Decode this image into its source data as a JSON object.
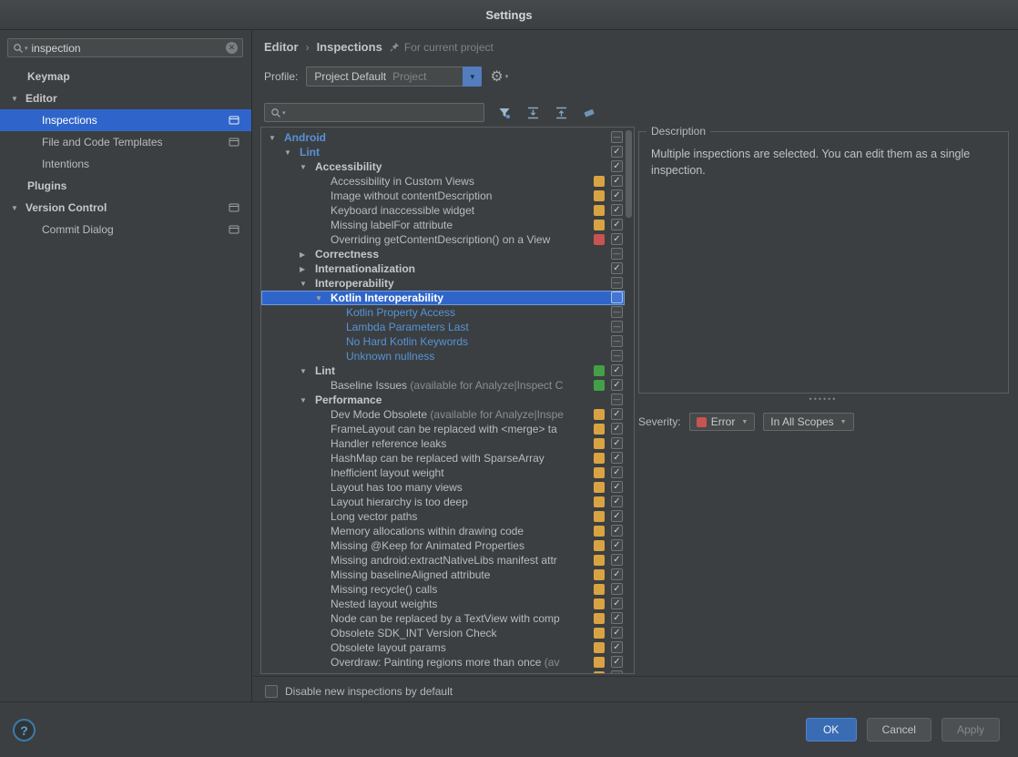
{
  "window": {
    "title": "Settings"
  },
  "colors": {
    "selection": "#2f65ca",
    "tree_link_blue": "#5693d8",
    "badge_yellow": "#d9a343",
    "badge_red": "#c75450",
    "badge_green": "#43a047",
    "severity_error": "#c75450",
    "ok_button": "#3a6cb4"
  },
  "sidebar": {
    "search": {
      "value": "inspection"
    },
    "items": [
      {
        "label": "Keymap",
        "indent": 1,
        "bold": true
      },
      {
        "label": "Editor",
        "indent": 0,
        "bold": true,
        "expander": "down"
      },
      {
        "label": "Inspections",
        "indent": 2,
        "selected": true,
        "scoped": true
      },
      {
        "label": "File and Code Templates",
        "indent": 2,
        "scoped": true
      },
      {
        "label": "Intentions",
        "indent": 2
      },
      {
        "label": "Plugins",
        "indent": 1,
        "bold": true
      },
      {
        "label": "Version Control",
        "indent": 0,
        "bold": true,
        "expander": "down",
        "scoped": true
      },
      {
        "label": "Commit Dialog",
        "indent": 2,
        "scoped": true
      }
    ]
  },
  "breadcrumb": {
    "path": [
      "Editor",
      "Inspections"
    ],
    "separator": "›",
    "scope_label": "For current project"
  },
  "profile": {
    "label": "Profile:",
    "value": "Project Default",
    "scope": "Project"
  },
  "tree": {
    "rows": [
      {
        "label": "Android",
        "level": 0,
        "bold": true,
        "color": "blue",
        "expander": "down",
        "check": "dash"
      },
      {
        "label": "Lint",
        "level": 1,
        "bold": true,
        "color": "blue",
        "expander": "down",
        "check": "checked"
      },
      {
        "label": "Accessibility",
        "level": 2,
        "bold": true,
        "expander": "down",
        "check": "checked"
      },
      {
        "label": "Accessibility in Custom Views",
        "level": 3,
        "badge": "yellow",
        "check": "checked"
      },
      {
        "label": "Image without contentDescription",
        "level": 3,
        "badge": "yellow",
        "check": "checked"
      },
      {
        "label": "Keyboard inaccessible widget",
        "level": 3,
        "badge": "yellow",
        "check": "checked"
      },
      {
        "label": "Missing labelFor attribute",
        "level": 3,
        "badge": "yellow",
        "check": "checked"
      },
      {
        "label": "Overriding getContentDescription() on a View",
        "level": 3,
        "badge": "red",
        "check": "checked"
      },
      {
        "label": "Correctness",
        "level": 2,
        "bold": true,
        "expander": "right",
        "check": "dash"
      },
      {
        "label": "Internationalization",
        "level": 2,
        "bold": true,
        "expander": "right",
        "check": "checked"
      },
      {
        "label": "Interoperability",
        "level": 2,
        "bold": true,
        "expander": "down",
        "check": "dash"
      },
      {
        "label": "Kotlin Interoperability",
        "level": 3,
        "bold": true,
        "expander": "down",
        "check": "empty",
        "selected": true
      },
      {
        "label": "Kotlin Property Access",
        "level": 4,
        "color": "blue",
        "check": "dash"
      },
      {
        "label": "Lambda Parameters Last",
        "level": 4,
        "color": "blue",
        "check": "dash"
      },
      {
        "label": "No Hard Kotlin Keywords",
        "level": 4,
        "color": "blue",
        "check": "dash"
      },
      {
        "label": "Unknown nullness",
        "level": 4,
        "color": "blue",
        "check": "dash"
      },
      {
        "label": "Lint",
        "level": 2,
        "bold": true,
        "expander": "down",
        "badge": "green",
        "check": "checked"
      },
      {
        "label": "Baseline Issues",
        "suffix": " (available for Analyze|Inspect C",
        "level": 3,
        "badge": "green",
        "check": "checked"
      },
      {
        "label": "Performance",
        "level": 2,
        "bold": true,
        "expander": "down",
        "check": "dash"
      },
      {
        "label": "Dev Mode Obsolete",
        "suffix": " (available for Analyze|Inspe",
        "level": 3,
        "badge": "yellow",
        "check": "checked"
      },
      {
        "label": "FrameLayout can be replaced with <merge> ta",
        "level": 3,
        "badge": "yellow",
        "check": "checked"
      },
      {
        "label": "Handler reference leaks",
        "level": 3,
        "badge": "yellow",
        "check": "checked"
      },
      {
        "label": "HashMap can be replaced with SparseArray",
        "level": 3,
        "badge": "yellow",
        "check": "checked"
      },
      {
        "label": "Inefficient layout weight",
        "level": 3,
        "badge": "yellow",
        "check": "checked"
      },
      {
        "label": "Layout has too many views",
        "level": 3,
        "badge": "yellow",
        "check": "checked"
      },
      {
        "label": "Layout hierarchy is too deep",
        "level": 3,
        "badge": "yellow",
        "check": "checked"
      },
      {
        "label": "Long vector paths",
        "level": 3,
        "badge": "yellow",
        "check": "checked"
      },
      {
        "label": "Memory allocations within drawing code",
        "level": 3,
        "badge": "yellow",
        "check": "checked"
      },
      {
        "label": "Missing @Keep for Animated Properties",
        "level": 3,
        "badge": "yellow",
        "check": "checked"
      },
      {
        "label": "Missing android:extractNativeLibs manifest attr",
        "level": 3,
        "badge": "yellow",
        "check": "checked"
      },
      {
        "label": "Missing baselineAligned attribute",
        "level": 3,
        "badge": "yellow",
        "check": "checked"
      },
      {
        "label": "Missing recycle() calls",
        "level": 3,
        "badge": "yellow",
        "check": "checked"
      },
      {
        "label": "Nested layout weights",
        "level": 3,
        "badge": "yellow",
        "check": "checked"
      },
      {
        "label": "Node can be replaced by a TextView with comp",
        "level": 3,
        "badge": "yellow",
        "check": "checked"
      },
      {
        "label": "Obsolete SDK_INT Version Check",
        "level": 3,
        "badge": "yellow",
        "check": "checked"
      },
      {
        "label": "Obsolete layout params",
        "level": 3,
        "badge": "yellow",
        "check": "checked"
      },
      {
        "label": "Overdraw: Painting regions more than once",
        "suffix": " (av",
        "level": 3,
        "badge": "yellow",
        "check": "checked"
      },
      {
        "label": "",
        "level": 3,
        "badge": "yellow",
        "check": "checked"
      }
    ]
  },
  "description": {
    "title": "Description",
    "text": "Multiple inspections are selected. You can edit them as a single inspection."
  },
  "severity": {
    "label": "Severity:",
    "value": "Error",
    "scope": "In All Scopes"
  },
  "options": {
    "disable_new_label": "Disable new inspections by default"
  },
  "footer": {
    "ok_label": "OK",
    "cancel_label": "Cancel",
    "apply_label": "Apply"
  }
}
